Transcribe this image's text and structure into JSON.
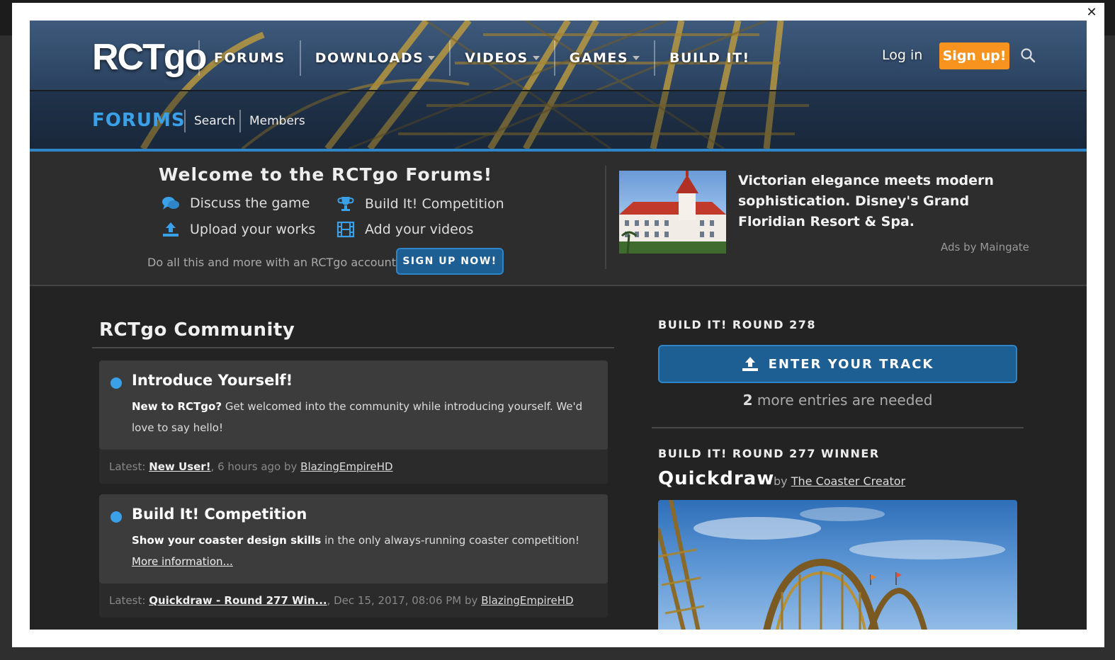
{
  "header": {
    "logo": "RCTgo",
    "nav": [
      {
        "label": "FORUMS",
        "dropdown": false
      },
      {
        "label": "DOWNLOADS",
        "dropdown": true
      },
      {
        "label": "VIDEOS",
        "dropdown": true
      },
      {
        "label": "GAMES",
        "dropdown": true
      },
      {
        "label": "BUILD IT!",
        "dropdown": false
      }
    ],
    "login_label": "Log in",
    "signup_label": "Sign up!",
    "search_icon": "search-icon",
    "accent": "#f7931e"
  },
  "subnav": {
    "title": "FORUMS",
    "links": [
      "Search",
      "Members"
    ],
    "accent": "#3aa0e8"
  },
  "welcome": {
    "title": "Welcome to the RCTgo Forums!",
    "features": [
      {
        "icon": "chat-bubbles-icon",
        "label": "Discuss the game"
      },
      {
        "icon": "trophy-icon",
        "label": "Build It! Competition"
      },
      {
        "icon": "upload-icon",
        "label": "Upload your works"
      },
      {
        "icon": "film-icon",
        "label": "Add your videos"
      }
    ],
    "cta_text": "Do all this and more with an RCTgo account:",
    "cta_button": "SIGN UP NOW!"
  },
  "ad": {
    "text": "Victorian elegance meets modern sophistication. Disney's Grand Floridian Resort & Spa.",
    "by": "Ads by Maingate"
  },
  "community": {
    "title": "RCTgo Community",
    "forums": [
      {
        "title": "Introduce Yourself!",
        "desc_bold": "New to RCTgo?",
        "desc": " Get welcomed into the community while introducing yourself. We'd love to say hello!",
        "desc_link": "",
        "latest_label": "Latest:",
        "latest_thread": "New User!",
        "latest_time": ", 6 hours ago by ",
        "latest_user": "BlazingEmpireHD"
      },
      {
        "title": "Build It! Competition",
        "desc_bold": "Show your coaster design skills",
        "desc": " in the only always-running coaster competition! ",
        "desc_link": "More information...",
        "latest_label": "Latest:",
        "latest_thread": "Quickdraw - Round 277 Win...",
        "latest_time": ", Dec 15, 2017, 08:06 PM by ",
        "latest_user": "BlazingEmpireHD"
      }
    ]
  },
  "sidebar": {
    "round_label": "BUILD IT! ROUND 278",
    "enter_button": "ENTER YOUR TRACK",
    "entries_count": "2",
    "entries_text": " more entries are needed",
    "winner_label": "BUILD IT! ROUND 277 WINNER",
    "winner_name": "Quickdraw",
    "winner_by": "by ",
    "winner_user": "The Coaster Creator"
  }
}
